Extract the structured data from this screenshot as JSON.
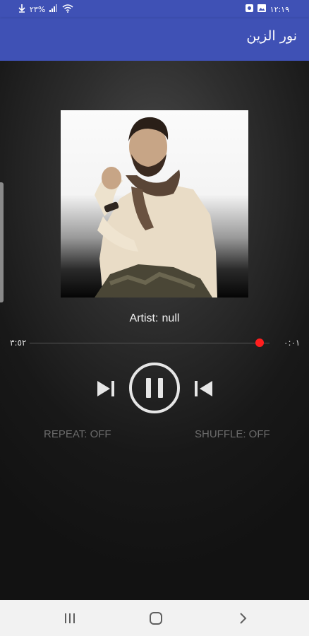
{
  "status_bar": {
    "time": "١٢:١٩",
    "battery": "٢٣%",
    "icons": [
      "download-icon",
      "signal-icon",
      "wifi-icon",
      "image-icon",
      "media-icon"
    ]
  },
  "app_bar": {
    "title": "نور الزين"
  },
  "player": {
    "artist_label": "Artist:",
    "artist_value": "null",
    "elapsed_time": "٠:٠١",
    "total_time": "٣:٥٢",
    "progress_fraction": 0.96,
    "repeat_label": "REPEAT: OFF",
    "shuffle_label": "SHUFFLE: OFF",
    "accent_color": "#ff1e1e"
  },
  "nav_bar": {
    "icons": [
      "recents-icon",
      "home-icon",
      "back-icon"
    ]
  }
}
